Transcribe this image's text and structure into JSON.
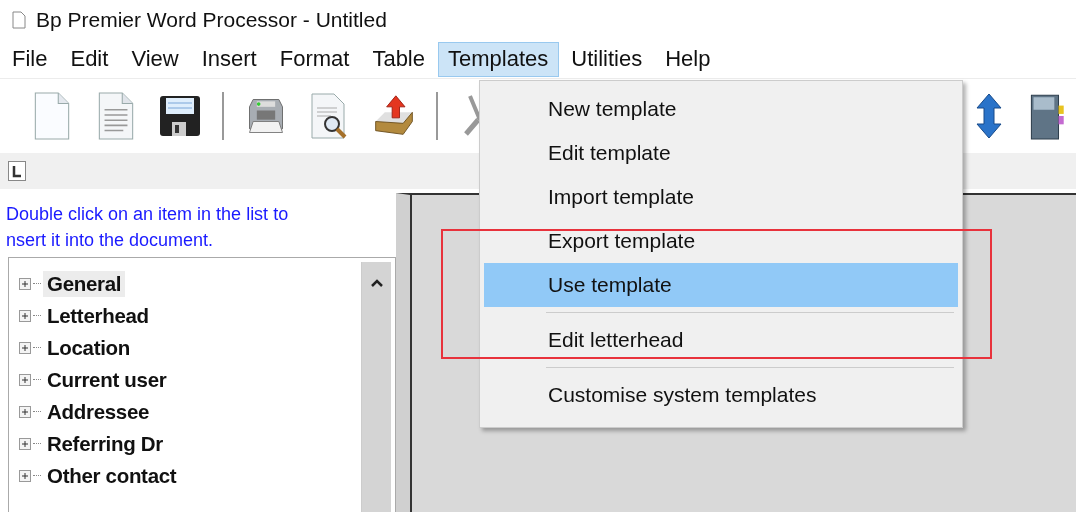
{
  "window": {
    "title": "Bp Premier Word Processor - Untitled"
  },
  "menu_bar": [
    {
      "label": "File",
      "selected": false
    },
    {
      "label": "Edit",
      "selected": false
    },
    {
      "label": "View",
      "selected": false
    },
    {
      "label": "Insert",
      "selected": false
    },
    {
      "label": "Format",
      "selected": false
    },
    {
      "label": "Table",
      "selected": false
    },
    {
      "label": "Templates",
      "selected": true
    },
    {
      "label": "Utilities",
      "selected": false
    },
    {
      "label": "Help",
      "selected": false
    }
  ],
  "toolbar": [
    {
      "kind": "blank"
    },
    {
      "kind": "page"
    },
    {
      "kind": "save"
    },
    {
      "kind": "sep"
    },
    {
      "kind": "printer"
    },
    {
      "kind": "preview"
    },
    {
      "kind": "export"
    },
    {
      "kind": "sep"
    },
    {
      "kind": "cut",
      "disabled": true
    }
  ],
  "toolbar_right": [
    {
      "kind": "updown"
    },
    {
      "kind": "binder"
    }
  ],
  "instructions": [
    "Double click on an item in the list to",
    "nsert it into the document."
  ],
  "tree": [
    {
      "label": "General",
      "expanded": false,
      "selected": true
    },
    {
      "label": "Letterhead",
      "expanded": false,
      "selected": false
    },
    {
      "label": "Location",
      "expanded": false,
      "selected": false
    },
    {
      "label": "Current user",
      "expanded": false,
      "selected": false
    },
    {
      "label": "Addressee",
      "expanded": false,
      "selected": false
    },
    {
      "label": "Referring Dr",
      "expanded": false,
      "selected": false
    },
    {
      "label": "Other contact",
      "expanded": false,
      "selected": false
    }
  ],
  "dropdown": [
    {
      "kind": "item",
      "label": "New template",
      "selected": false
    },
    {
      "kind": "item",
      "label": "Edit template",
      "selected": false
    },
    {
      "kind": "item",
      "label": "Import template",
      "selected": false
    },
    {
      "kind": "item",
      "label": "Export template",
      "selected": false
    },
    {
      "kind": "item",
      "label": "Use template",
      "selected": true
    },
    {
      "kind": "separator"
    },
    {
      "kind": "item",
      "label": "Edit letterhead",
      "selected": false
    },
    {
      "kind": "separator"
    },
    {
      "kind": "item",
      "label": "Customise system templates",
      "selected": false
    }
  ]
}
